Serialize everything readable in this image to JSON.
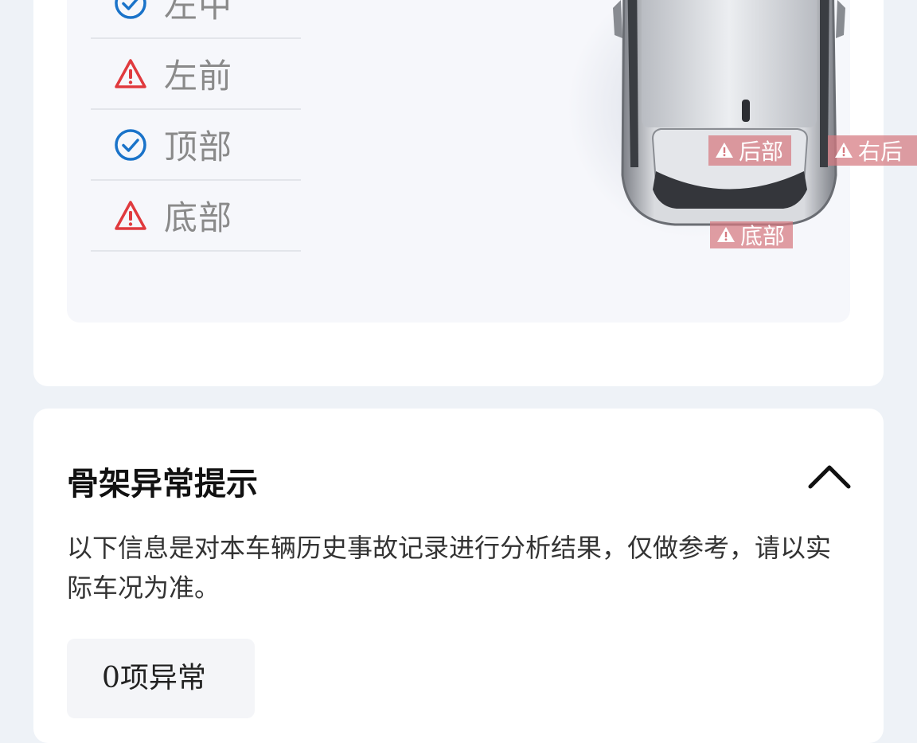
{
  "parts_panel": {
    "items": [
      {
        "label": "左中",
        "status": "ok"
      },
      {
        "label": "左前",
        "status": "warning"
      },
      {
        "label": "顶部",
        "status": "ok"
      },
      {
        "label": "底部",
        "status": "warning"
      }
    ]
  },
  "car_tags": {
    "rear": "后部",
    "right_rear": "右后",
    "bottom": "底部"
  },
  "frame_section": {
    "title": "骨架异常提示",
    "description": "以下信息是对本车辆历史事故记录进行分析结果，仅做参考，请以实际车况为准。",
    "count_label": "0项异常"
  },
  "colors": {
    "ok": "#1a73c9",
    "warning": "#e03a3e",
    "tag_bg": "#d6787f"
  },
  "icons": {
    "ok": "check-circle-icon",
    "warning": "warning-triangle-icon",
    "collapse": "chevron-up-icon"
  }
}
